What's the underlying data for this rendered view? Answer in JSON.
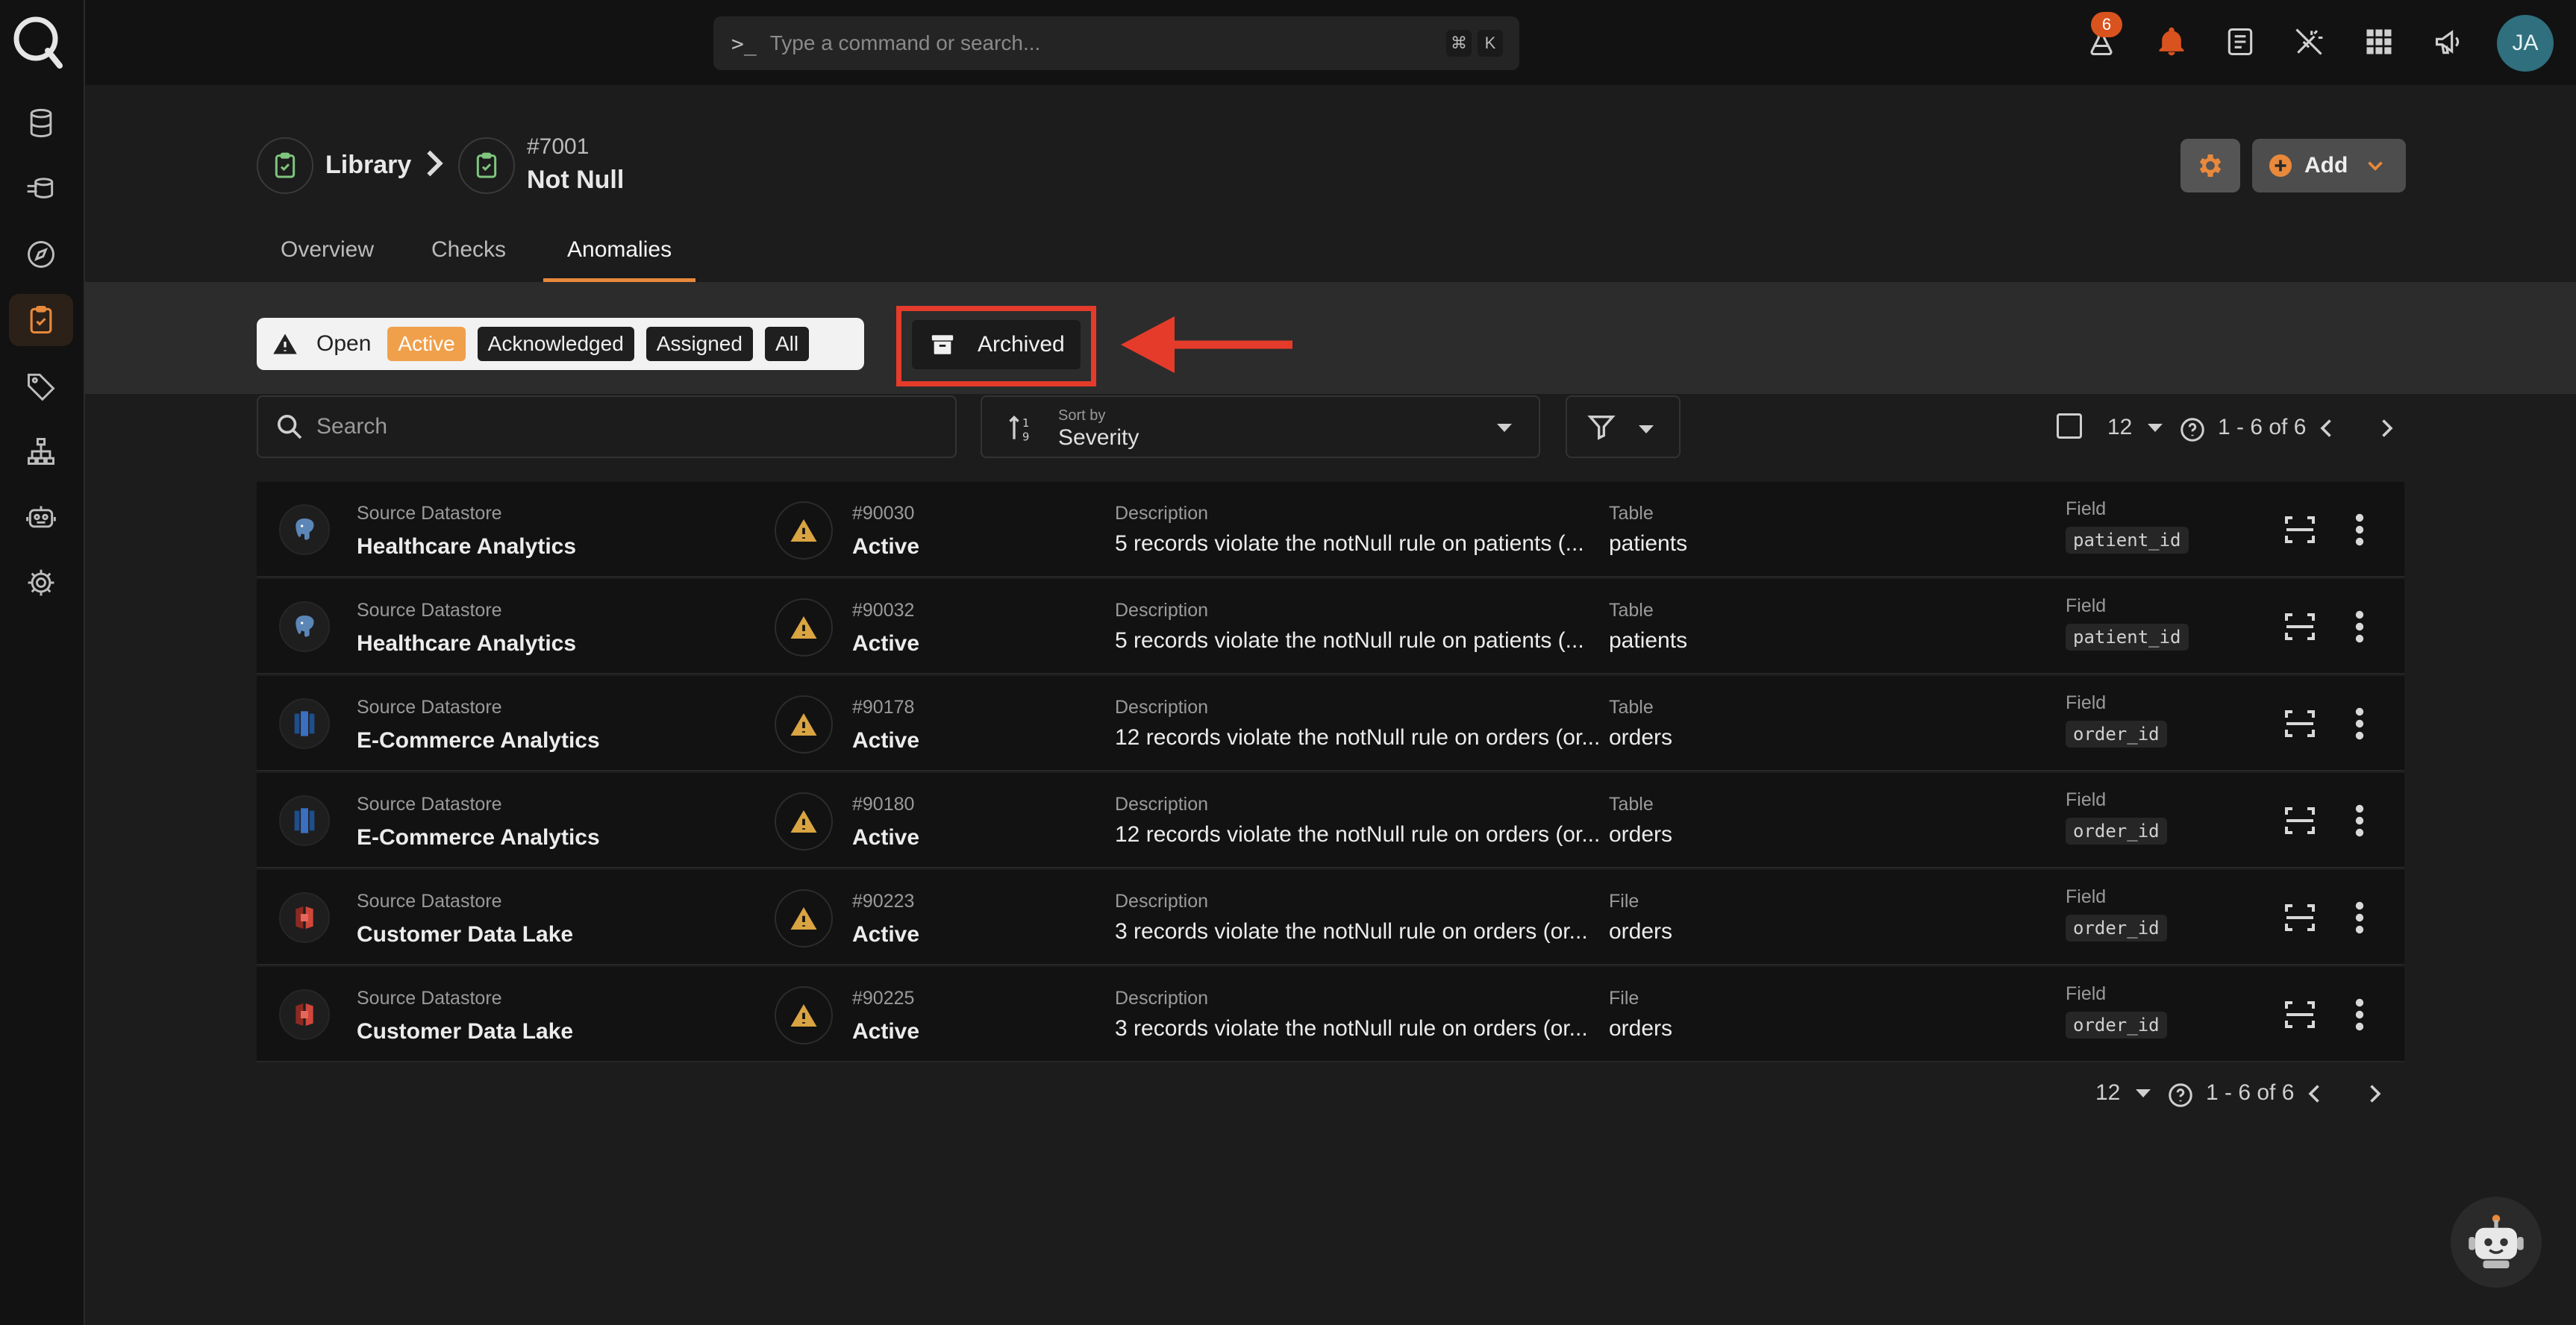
{
  "topbar": {
    "command_prompt": ">_",
    "search_placeholder": "Type a command or search...",
    "shortcut_keys": [
      "⌘",
      "K"
    ],
    "notification_count": "6",
    "avatar_initials": "JA"
  },
  "sidebar": {
    "items": [
      {
        "name": "datastores",
        "icon": "database-icon"
      },
      {
        "name": "pipelines",
        "icon": "flow-icon"
      },
      {
        "name": "explore",
        "icon": "compass-icon"
      },
      {
        "name": "library",
        "icon": "clipboard-check-icon",
        "active": true
      },
      {
        "name": "tags",
        "icon": "tag-icon"
      },
      {
        "name": "hierarchy",
        "icon": "sitemap-icon"
      },
      {
        "name": "agents",
        "icon": "robot-icon"
      },
      {
        "name": "settings",
        "icon": "gear-icon"
      }
    ]
  },
  "header": {
    "breadcrumb_root": "Library",
    "check_id": "#7001",
    "check_name": "Not Null",
    "add_label": "Add"
  },
  "tabs": [
    "Overview",
    "Checks",
    "Anomalies"
  ],
  "active_tab": "Anomalies",
  "filters": {
    "group_label": "Open",
    "chips": [
      "Active",
      "Acknowledged",
      "Assigned",
      "All"
    ],
    "selected_chip": "Active",
    "archived_label": "Archived"
  },
  "toolbar": {
    "search_placeholder": "Search",
    "sort_caption": "Sort by",
    "sort_value": "Severity",
    "page_size": "12",
    "range_text": "1 - 6 of 6"
  },
  "labels": {
    "source": "Source Datastore",
    "description": "Description",
    "field": "Field"
  },
  "rows": [
    {
      "datastore": "Healthcare Analytics",
      "ds_icon": "postgres-icon",
      "id": "#90030",
      "status": "Active",
      "description": "5 records violate the notNull rule on patients (...",
      "container_label": "Table",
      "container": "patients",
      "field": "patient_id"
    },
    {
      "datastore": "Healthcare Analytics",
      "ds_icon": "postgres-icon",
      "id": "#90032",
      "status": "Active",
      "description": "5 records violate the notNull rule on patients (...",
      "container_label": "Table",
      "container": "patients",
      "field": "patient_id"
    },
    {
      "datastore": "E-Commerce Analytics",
      "ds_icon": "redshift-icon",
      "id": "#90178",
      "status": "Active",
      "description": "12 records violate the notNull rule on orders (or...",
      "container_label": "Table",
      "container": "orders",
      "field": "order_id"
    },
    {
      "datastore": "E-Commerce Analytics",
      "ds_icon": "redshift-icon",
      "id": "#90180",
      "status": "Active",
      "description": "12 records violate the notNull rule on orders (or...",
      "container_label": "Table",
      "container": "orders",
      "field": "order_id"
    },
    {
      "datastore": "Customer Data Lake",
      "ds_icon": "s3-icon",
      "id": "#90223",
      "status": "Active",
      "description": "3 records violate the notNull rule on orders (or...",
      "container_label": "File",
      "container": "orders",
      "field": "order_id"
    },
    {
      "datastore": "Customer Data Lake",
      "ds_icon": "s3-icon",
      "id": "#90225",
      "status": "Active",
      "description": "3 records violate the notNull rule on orders (or...",
      "container_label": "File",
      "container": "orders",
      "field": "order_id"
    }
  ],
  "colors": {
    "accent": "#f0a04b",
    "highlight": "#e53b2b",
    "warning": "#d9a441"
  }
}
